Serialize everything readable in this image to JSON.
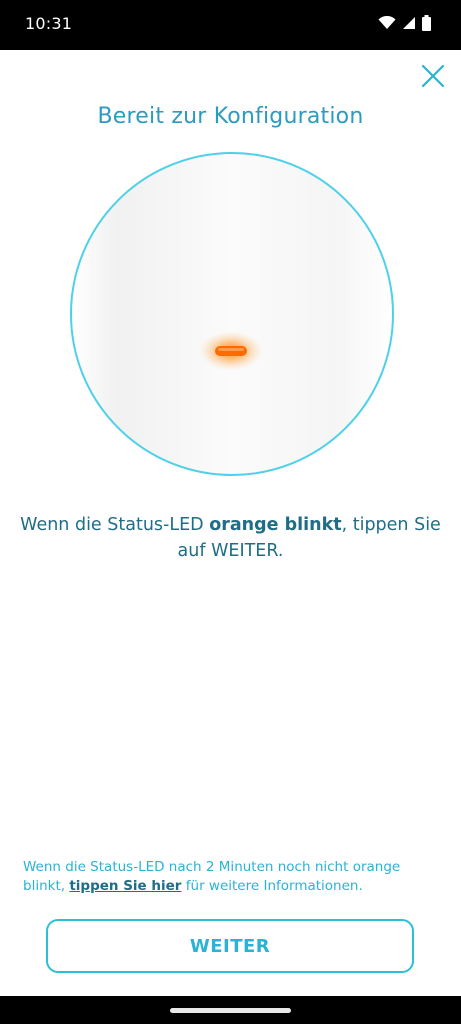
{
  "status_bar": {
    "time": "10:31",
    "icons": [
      "wifi-icon",
      "signal-icon",
      "battery-icon"
    ]
  },
  "header": {
    "close_icon": "close-icon",
    "title": "Bereit zur Konfiguration"
  },
  "illustration": {
    "led_color": "#ff6a00",
    "ring_color": "#4fd0ea"
  },
  "instruction": {
    "before": "Wenn die Status-LED ",
    "highlight": "orange blinkt",
    "after": ", tippen Sie auf WEITER."
  },
  "footnote": {
    "before": "Wenn die Status-LED nach 2 Minuten noch nicht orange blinkt, ",
    "link": "tippen Sie hier",
    "after": " für weitere Informationen."
  },
  "primary_button": {
    "label": "WEITER"
  },
  "colors": {
    "accent": "#2bb3d6",
    "title": "#2b9bbf",
    "body_text": "#1f6d86"
  }
}
